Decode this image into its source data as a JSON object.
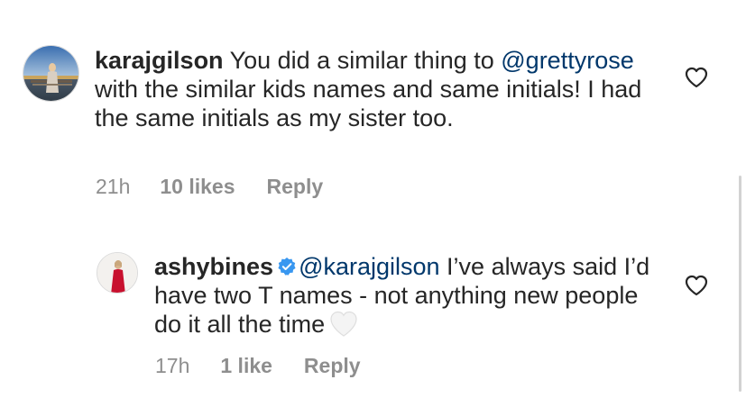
{
  "comments": [
    {
      "username": "karajgilson",
      "text_before": " You did a similar thing to ",
      "mention": "@grettyrose",
      "text_after": " with the similar kids names and same initials! I had the same initials as my sister too.",
      "time": "21h",
      "likes": "10 likes",
      "reply_label": "Reply",
      "like_icon": "heart-outline-icon"
    },
    {
      "username": "ashybines",
      "verified_icon": "verified-badge-icon",
      "mention": "@karajgilson",
      "text_after": " I’ve always said I’d have two T names - not anything new people do it all the time",
      "emoji_icon": "white-heart-emoji-icon",
      "time": "17h",
      "likes": "1 like",
      "reply_label": "Reply",
      "like_icon": "heart-outline-icon"
    }
  ],
  "colors": {
    "text": "#262626",
    "mention": "#00376b",
    "meta": "#8e8e8e",
    "verified": "#3897f0"
  }
}
